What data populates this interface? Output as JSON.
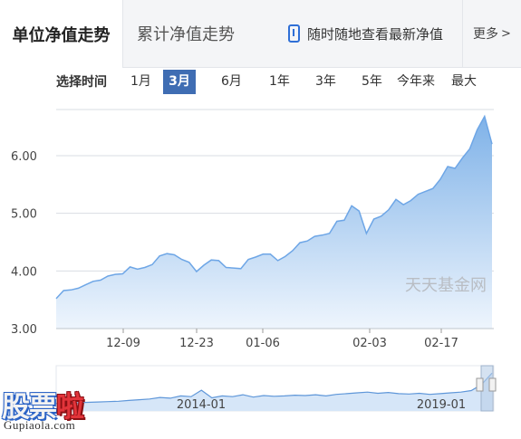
{
  "tabs": {
    "unit_nav": "单位净值走势",
    "cumulative_nav": "累计净值走势",
    "app_promo": "随时随地查看最新净值",
    "more": "更多",
    "more_icon": "chevron-right-icon"
  },
  "range": {
    "label": "选择时间",
    "options": [
      "1月",
      "3月",
      "6月",
      "1年",
      "3年",
      "5年",
      "今年来",
      "最大"
    ],
    "selected": "3月"
  },
  "colors": {
    "accent": "#3f6db3",
    "area_fill_top": "#7fb2e8",
    "area_fill_bottom": "#eef5fd",
    "line": "#6ea6e6"
  },
  "chart_data": {
    "type": "area",
    "title": "",
    "xlabel": "",
    "ylabel": "",
    "ylim": [
      3.0,
      6.8
    ],
    "yticks": [
      "3.00",
      "4.00",
      "5.00",
      "6.00"
    ],
    "xticks": [
      "12-09",
      "12-23",
      "01-06",
      "02-03",
      "02-17"
    ],
    "watermark": "天天基金网",
    "series": [
      {
        "values": [
          3.52,
          3.66,
          3.67,
          3.7,
          3.76,
          3.82,
          3.84,
          3.91,
          3.94,
          3.95,
          4.07,
          4.03,
          4.06,
          4.11,
          4.26,
          4.3,
          4.28,
          4.2,
          4.15,
          3.99,
          4.1,
          4.19,
          4.18,
          4.06,
          4.05,
          4.04,
          4.2,
          4.24,
          4.29,
          4.29,
          4.18,
          4.25,
          4.35,
          4.49,
          4.52,
          4.6,
          4.62,
          4.65,
          4.86,
          4.88,
          5.13,
          5.04,
          4.65,
          4.9,
          4.95,
          5.06,
          5.24,
          5.15,
          5.22,
          5.33,
          5.38,
          5.43,
          5.59,
          5.81,
          5.78,
          5.96,
          6.12,
          6.45,
          6.68,
          6.2
        ]
      }
    ],
    "navigator": {
      "labels": [
        "2014-01",
        "2019-01"
      ]
    }
  },
  "logo": {
    "text": "股票啦",
    "url_text": "Gupiaola.com"
  }
}
